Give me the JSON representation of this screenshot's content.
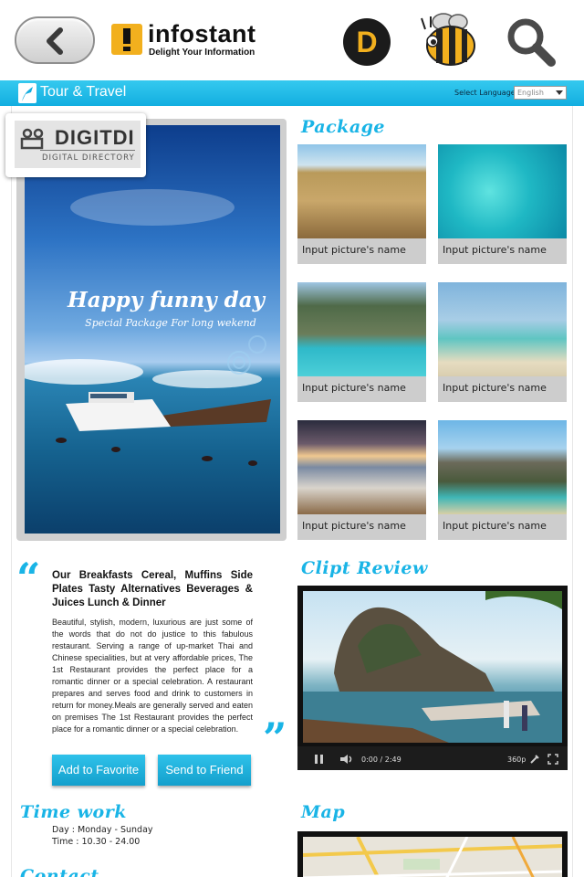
{
  "header": {
    "brand_name": "infostant",
    "brand_tagline": "Delight Your Information",
    "d_button_label": "D"
  },
  "tour_bar": {
    "title": "Tour & Travel",
    "language_label": "Select Language",
    "language_value": "English"
  },
  "badge": {
    "title": "DIGITDI",
    "subtitle": "DIGITAL DIRECTORY"
  },
  "hero": {
    "headline": "Happy funny day",
    "subline": "Special Package For long wekend"
  },
  "package": {
    "heading": "Package",
    "items": [
      {
        "caption": "Input picture's name"
      },
      {
        "caption": "Input picture's name"
      },
      {
        "caption": "Input picture's name"
      },
      {
        "caption": "Input picture's name"
      },
      {
        "caption": "Input picture's name"
      },
      {
        "caption": "Input picture's name"
      }
    ]
  },
  "description": {
    "quote_open": "“",
    "quote_close": "”",
    "title": "Our Breakfasts Cereal, Muffins Side Plates Tasty Alternatives Beverages & Juices Lunch & Dinner",
    "body": "Beautiful, stylish, modern, luxurious are just some of the words that do not do justice to this fabulous restaurant. Serving a range of up-market Thai and Chinese specialities, but at very affordable prices, The 1st Restaurant provides the perfect place for a romantic dinner or a special celebration. A restaurant prepares and serves food and drink to customers in return for money.Meals are generally served and eaten on premises The 1st Restaurant provides the perfect place for a romantic dinner or a special celebration."
  },
  "actions": {
    "favorite": "Add to Favorite",
    "send": "Send to Friend"
  },
  "clip": {
    "heading": "Clipt Review",
    "time": "0:00 / 2:49",
    "quality": "360p"
  },
  "time_work": {
    "heading": "Time work",
    "day": "Day : Monday - Sunday",
    "time": "Time : 10.30 - 24.00"
  },
  "map": {
    "heading": "Map"
  },
  "contact": {
    "heading": "Contact"
  },
  "colors": {
    "accent": "#19b4e6",
    "logo_yellow": "#f2b01e"
  }
}
